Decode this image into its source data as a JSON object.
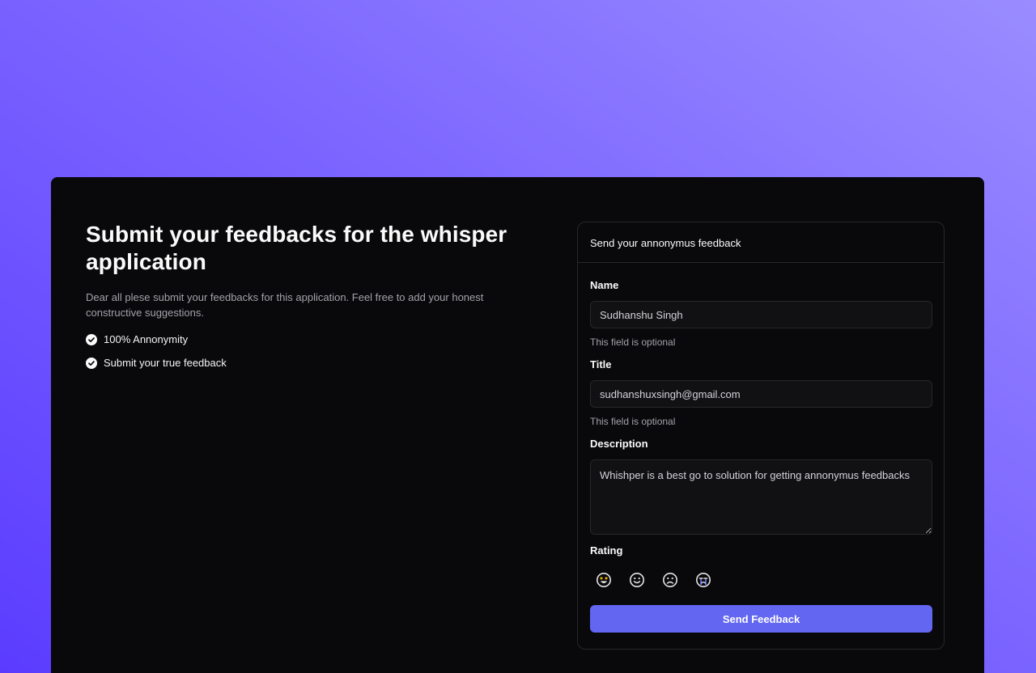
{
  "left": {
    "headline": "Submit your feedbacks for the whisper application",
    "intro": "Dear all plese submit your feedbacks for this application. Feel free to add your honest constructive suggestions.",
    "features": [
      "100% Annonymity",
      "Submit your true feedback"
    ]
  },
  "form": {
    "header": "Send your annonymus feedback",
    "name_label": "Name",
    "name_value": "Sudhanshu Singh",
    "name_hint": "This field is optional",
    "title_label": "Title",
    "title_value": "sudhanshuxsingh@gmail.com",
    "title_hint": "This field is optional",
    "description_label": "Description",
    "description_value": "Whishper is a best go to solution for getting annonymus feedbacks",
    "rating_label": "Rating",
    "rating_icons": [
      "star-struck-face-icon",
      "smiling-face-icon",
      "frowning-face-icon",
      "crying-face-icon"
    ],
    "submit_label": "Send Feedback"
  },
  "colors": {
    "accent": "#6366f1",
    "card_bg": "#09090b",
    "border": "#27272a",
    "star_gold": "#f5b400",
    "tear_blue": "#6b7cff"
  }
}
